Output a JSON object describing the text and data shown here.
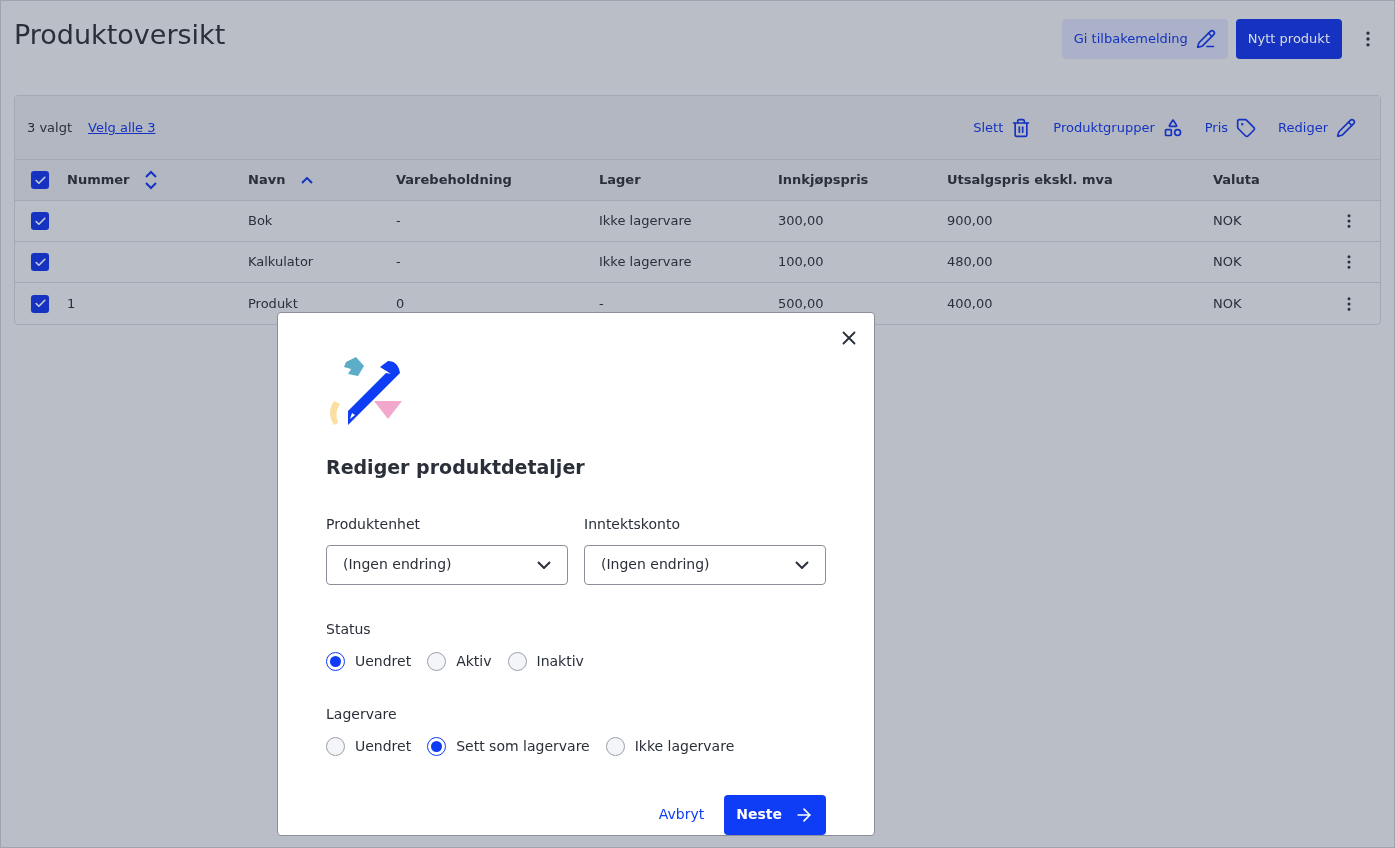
{
  "page": {
    "title": "Produktoversikt",
    "feedback_button": "Gi tilbakemelding",
    "new_button": "Nytt produkt"
  },
  "toolbar": {
    "selected_count": "3 valgt",
    "select_all": "Velg alle 3",
    "actions": [
      {
        "kind": "delete",
        "label": "Slett"
      },
      {
        "kind": "groups",
        "label": "Produktgrupper"
      },
      {
        "kind": "price",
        "label": "Pris"
      },
      {
        "kind": "edit",
        "label": "Rediger"
      }
    ]
  },
  "table": {
    "all_checked": true,
    "columns": [
      {
        "label": "Nummer",
        "sortable": true,
        "sorted": false
      },
      {
        "label": "Navn",
        "sortable": true,
        "sorted": true
      },
      {
        "label": "Varebeholdning"
      },
      {
        "label": "Lager"
      },
      {
        "label": "Innkjøpspris"
      },
      {
        "label": "Utsalgspris ekskl. mva"
      },
      {
        "label": "Valuta"
      }
    ],
    "rows": [
      {
        "checked": true,
        "cells": [
          "",
          "Bok",
          "-",
          "Ikke lagervare",
          "300,00",
          "900,00",
          "NOK"
        ]
      },
      {
        "checked": true,
        "cells": [
          "",
          "Kalkulator",
          "-",
          "Ikke lagervare",
          "100,00",
          "480,00",
          "NOK"
        ]
      },
      {
        "checked": true,
        "cells": [
          "1",
          "Produkt",
          "0",
          "-",
          "500,00",
          "400,00",
          "NOK"
        ]
      }
    ]
  },
  "dialog": {
    "title": "Rediger produktdetaljer",
    "selects": [
      {
        "label": "Produktenhet",
        "value": "(Ingen endring)"
      },
      {
        "label": "Inntektskonto",
        "value": "(Ingen endring)"
      }
    ],
    "radio_groups": [
      {
        "label": "Status",
        "options": [
          {
            "label": "Uendret",
            "selected": true
          },
          {
            "label": "Aktiv",
            "selected": false
          },
          {
            "label": "Inaktiv",
            "selected": false
          }
        ]
      },
      {
        "label": "Lagervare",
        "options": [
          {
            "label": "Uendret",
            "selected": false
          },
          {
            "label": "Sett som lagervare",
            "selected": true
          },
          {
            "label": "Ikke lagervare",
            "selected": false
          }
        ]
      }
    ],
    "cancel": "Avbryt",
    "next": "Neste"
  }
}
